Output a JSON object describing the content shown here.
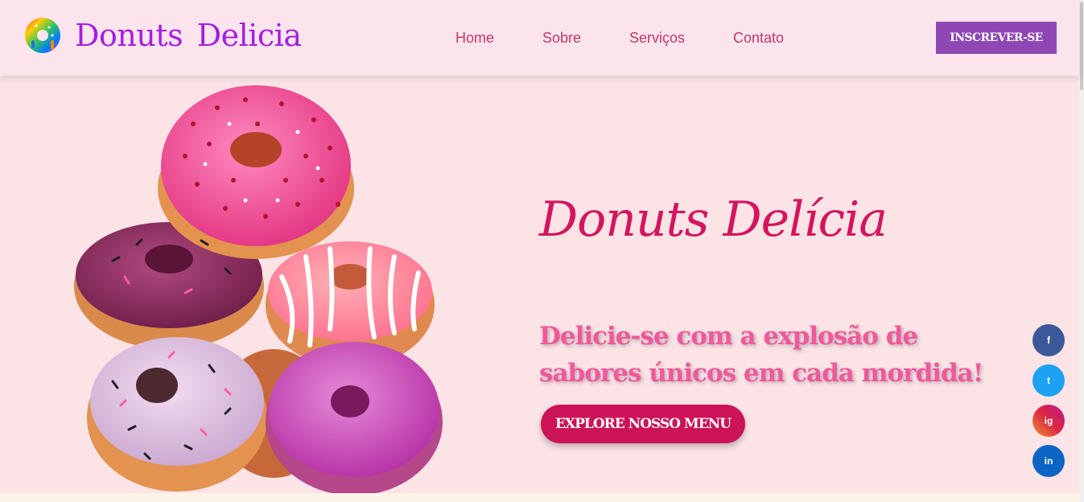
{
  "header": {
    "brand": "Donuts Delicia",
    "nav": [
      "Home",
      "Sobre",
      "Serviços",
      "Contato"
    ],
    "subscribe_label": "INSCREVER-SE"
  },
  "hero": {
    "title": "Donuts Delícia",
    "subtitle": "Delicie-se com a explosão de sabores únicos em cada mordida!",
    "cta_label": "EXPLORE NOSSO MENU"
  },
  "social": {
    "facebook": "f",
    "twitter": "t",
    "instagram": "ig",
    "linkedin": "in"
  },
  "colors": {
    "brand_purple": "#a61ee0",
    "accent_pink": "#cc1357",
    "subscribe_purple": "#8e47b4"
  }
}
